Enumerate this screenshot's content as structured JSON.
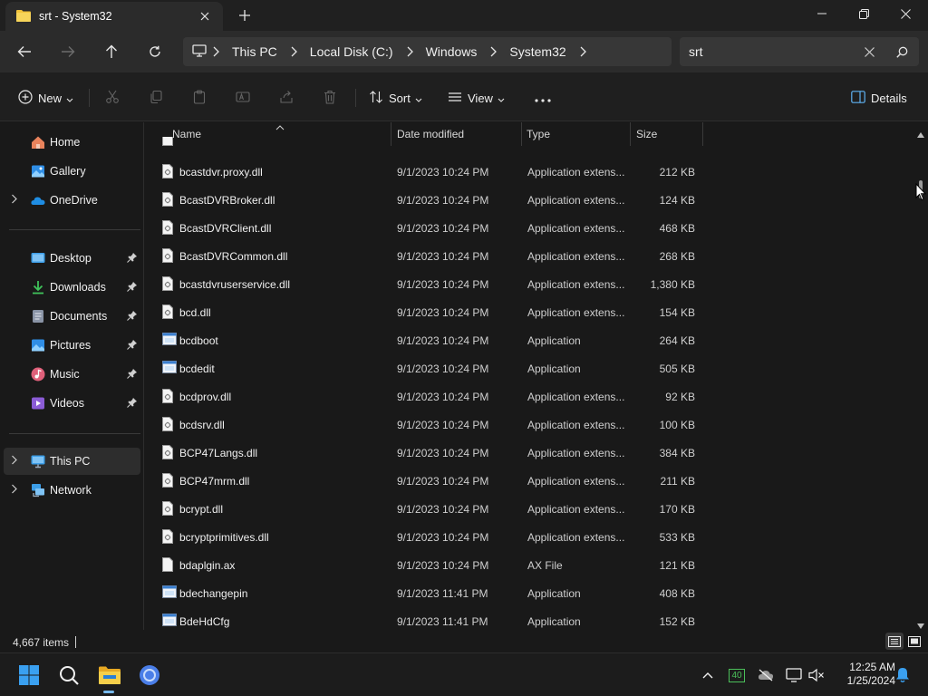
{
  "window": {
    "tab_title": "srt - System32",
    "icons": [
      "folder-icon",
      "close-icon",
      "plus-icon",
      "minimize-icon",
      "restore-icon",
      "close-icon"
    ]
  },
  "nav": {
    "breadcrumbs": [
      "This PC",
      "Local Disk (C:)",
      "Windows",
      "System32"
    ],
    "search_value": "srt"
  },
  "toolbar": {
    "new_label": "New",
    "sort_label": "Sort",
    "view_label": "View",
    "details_label": "Details"
  },
  "sidebar": {
    "items": [
      {
        "label": "Home",
        "icon": "home-icon"
      },
      {
        "label": "Gallery",
        "icon": "gallery-icon"
      },
      {
        "label": "OneDrive",
        "icon": "onedrive-icon"
      },
      {
        "label": "Desktop",
        "icon": "desktop-icon"
      },
      {
        "label": "Downloads",
        "icon": "downloads-icon"
      },
      {
        "label": "Documents",
        "icon": "documents-icon"
      },
      {
        "label": "Pictures",
        "icon": "pictures-icon"
      },
      {
        "label": "Music",
        "icon": "music-icon"
      },
      {
        "label": "Videos",
        "icon": "videos-icon"
      },
      {
        "label": "This PC",
        "icon": "this-pc-icon"
      },
      {
        "label": "Network",
        "icon": "network-icon"
      }
    ]
  },
  "columns": {
    "name": "Name",
    "date": "Date modified",
    "type": "Type",
    "size": "Size"
  },
  "files": [
    {
      "name": "bcastdvr.proxy.dll",
      "date": "9/1/2023 10:24 PM",
      "type": "Application extens...",
      "size": "212 KB",
      "kind": "dll"
    },
    {
      "name": "BcastDVRBroker.dll",
      "date": "9/1/2023 10:24 PM",
      "type": "Application extens...",
      "size": "124 KB",
      "kind": "dll"
    },
    {
      "name": "BcastDVRClient.dll",
      "date": "9/1/2023 10:24 PM",
      "type": "Application extens...",
      "size": "468 KB",
      "kind": "dll"
    },
    {
      "name": "BcastDVRCommon.dll",
      "date": "9/1/2023 10:24 PM",
      "type": "Application extens...",
      "size": "268 KB",
      "kind": "dll"
    },
    {
      "name": "bcastdvruserservice.dll",
      "date": "9/1/2023 10:24 PM",
      "type": "Application extens...",
      "size": "1,380 KB",
      "kind": "dll"
    },
    {
      "name": "bcd.dll",
      "date": "9/1/2023 10:24 PM",
      "type": "Application extens...",
      "size": "154 KB",
      "kind": "dll"
    },
    {
      "name": "bcdboot",
      "date": "9/1/2023 10:24 PM",
      "type": "Application",
      "size": "264 KB",
      "kind": "exe"
    },
    {
      "name": "bcdedit",
      "date": "9/1/2023 10:24 PM",
      "type": "Application",
      "size": "505 KB",
      "kind": "exe"
    },
    {
      "name": "bcdprov.dll",
      "date": "9/1/2023 10:24 PM",
      "type": "Application extens...",
      "size": "92 KB",
      "kind": "dll"
    },
    {
      "name": "bcdsrv.dll",
      "date": "9/1/2023 10:24 PM",
      "type": "Application extens...",
      "size": "100 KB",
      "kind": "dll"
    },
    {
      "name": "BCP47Langs.dll",
      "date": "9/1/2023 10:24 PM",
      "type": "Application extens...",
      "size": "384 KB",
      "kind": "dll"
    },
    {
      "name": "BCP47mrm.dll",
      "date": "9/1/2023 10:24 PM",
      "type": "Application extens...",
      "size": "211 KB",
      "kind": "dll"
    },
    {
      "name": "bcrypt.dll",
      "date": "9/1/2023 10:24 PM",
      "type": "Application extens...",
      "size": "170 KB",
      "kind": "dll"
    },
    {
      "name": "bcryptprimitives.dll",
      "date": "9/1/2023 10:24 PM",
      "type": "Application extens...",
      "size": "533 KB",
      "kind": "dll"
    },
    {
      "name": "bdaplgin.ax",
      "date": "9/1/2023 10:24 PM",
      "type": "AX File",
      "size": "121 KB",
      "kind": "file"
    },
    {
      "name": "bdechangepin",
      "date": "9/1/2023 11:41 PM",
      "type": "Application",
      "size": "408 KB",
      "kind": "exe"
    },
    {
      "name": "BdeHdCfg",
      "date": "9/1/2023 11:41 PM",
      "type": "Application",
      "size": "152 KB",
      "kind": "exe"
    }
  ],
  "status": {
    "item_count": "4,667 items"
  },
  "taskbar": {
    "tray_badge": "40",
    "time": "12:25 AM",
    "date": "1/25/2024"
  }
}
